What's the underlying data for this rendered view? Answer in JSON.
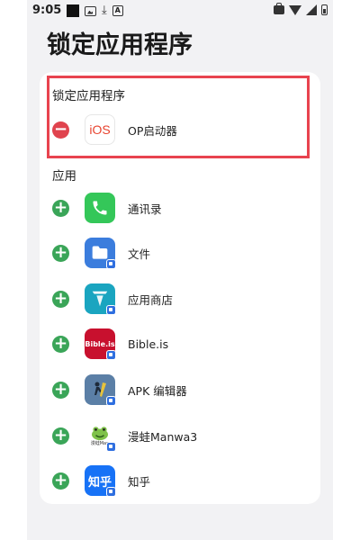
{
  "status_bar": {
    "time": "9:05",
    "left_icons": [
      "black-square-icon",
      "image-icon",
      "download-icon",
      "a-box-icon"
    ],
    "right_icons": [
      "briefcase-icon",
      "wifi-icon",
      "signal-icon",
      "battery-icon"
    ]
  },
  "page_title": "锁定应用程序",
  "locked_section": {
    "label": "锁定应用程序",
    "items": [
      {
        "name": "OP启动器",
        "icon_text": "iOS",
        "icon_color": "#ffffff",
        "action": "remove"
      }
    ]
  },
  "apps_section": {
    "label": "应用",
    "items": [
      {
        "name": "通讯录",
        "icon": "phone-icon",
        "icon_color": "#34c759",
        "action": "add"
      },
      {
        "name": "文件",
        "icon": "folder-icon",
        "icon_color": "#3b7ddd",
        "action": "add"
      },
      {
        "name": "应用商店",
        "icon": "store-icon",
        "icon_color": "#1aa5c0",
        "action": "add"
      },
      {
        "name": "Bible.is",
        "icon_text": "Bible.is",
        "icon_color": "#c8102e",
        "action": "add"
      },
      {
        "name": "APK 编辑器",
        "icon": "apk-editor-icon",
        "icon_color": "#5b7fa6",
        "action": "add"
      },
      {
        "name": "漫蛙Manwa3",
        "icon": "frog-icon",
        "icon_text": "漫蛙Man",
        "icon_color": "#ffffff",
        "action": "add"
      },
      {
        "name": "知乎",
        "icon_text": "知乎",
        "icon_color": "#1772f6",
        "action": "add"
      }
    ]
  },
  "colors": {
    "highlight_border": "#e8434f",
    "add_toggle": "#3aa558",
    "remove_toggle": "#e0434e",
    "work_badge": "#2f6fe0"
  }
}
